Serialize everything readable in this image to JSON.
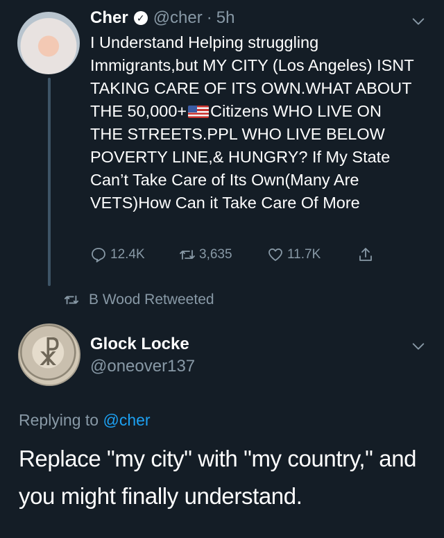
{
  "tweet": {
    "author_name": "Cher",
    "verified": true,
    "handle": "@cher",
    "separator": "·",
    "time": "5h",
    "text_before_flag": "I Understand Helping struggling Immigrants,but MY CITY (Los Angeles) ISNT TAKING CARE OF ITS OWN.WHAT ABOUT THE 50,000+",
    "text_after_flag": "Citizens WHO LIVE ON THE STREETS.PPL WHO LIVE BELOW POVERTY LINE,& HUNGRY? If My State Can’t Take Care of Its Own(Many Are VETS)How Can it Take Care Of More",
    "replies_count": "12.4K",
    "retweets_count": "3,635",
    "likes_count": "11.7K"
  },
  "retweet_note": "B Wood Retweeted",
  "reply": {
    "author_name": "Glock Locke",
    "handle": "@oneover137",
    "replying_prefix": "Replying to",
    "replying_to": "@cher",
    "text": "Replace \"my city\" with \"my country,\" and you might finally understand."
  },
  "colors": {
    "background": "#141d26",
    "secondary_text": "#8899a6",
    "link": "#1da1f2",
    "thread_line": "#3d5466"
  },
  "icons": [
    "verified-icon",
    "chevron-down-icon",
    "reply-icon",
    "retweet-icon",
    "like-icon",
    "share-icon",
    "flag-usa-icon"
  ]
}
